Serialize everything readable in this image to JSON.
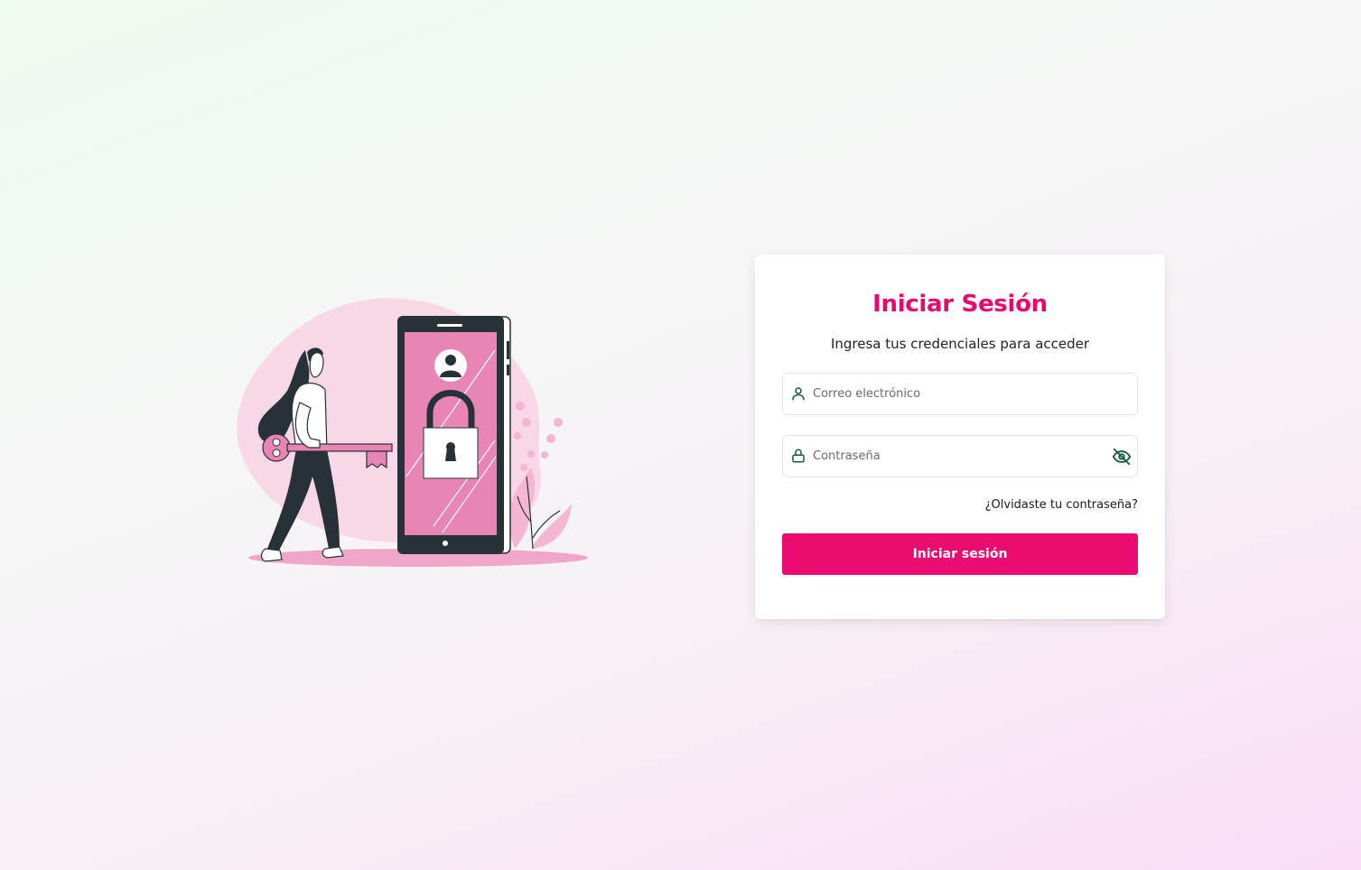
{
  "colors": {
    "accent": "#ea0c70",
    "title": "#e8086f",
    "icon": "#0e5a3a",
    "illustration_pink": "#e885b4",
    "illustration_dark": "#263238"
  },
  "illustration": {
    "icon": "woman-with-key-phone-lock-illustration"
  },
  "login": {
    "title": "Iniciar Sesión",
    "subtitle": "Ingresa tus credenciales para acceder",
    "email": {
      "icon": "user-icon",
      "value": "",
      "placeholder": "Correo electrónico"
    },
    "password": {
      "icon": "lock-icon",
      "value": "",
      "placeholder": "Contraseña",
      "toggle_icon": "eye-off-icon"
    },
    "forgot_label": "¿Olvidaste tu contraseña?",
    "submit_label": "Iniciar sesión"
  }
}
